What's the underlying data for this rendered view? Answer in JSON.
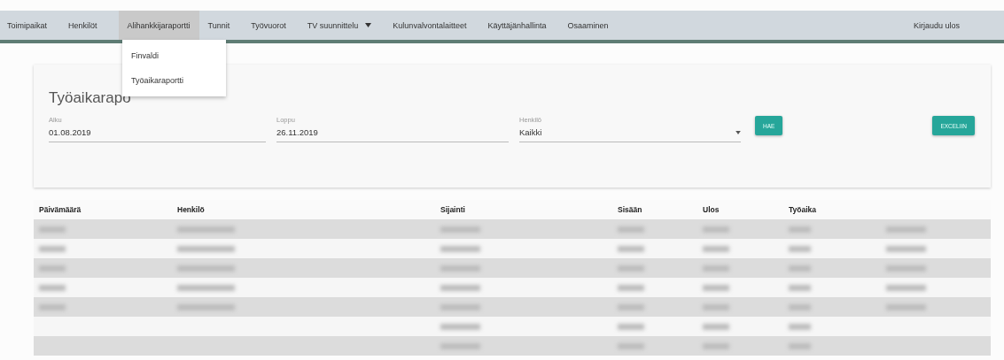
{
  "nav": {
    "items": [
      {
        "label": "Toimipaikat",
        "selected": false,
        "dropdown": false
      },
      {
        "label": "Henkilöt",
        "selected": false,
        "dropdown": false
      },
      {
        "label": "Alihankkijaraportti",
        "selected": true,
        "dropdown": false
      },
      {
        "label": "Tunnit",
        "selected": false,
        "dropdown": false
      },
      {
        "label": "Työvuorot",
        "selected": false,
        "dropdown": false
      },
      {
        "label": "TV suunnittelu",
        "selected": false,
        "dropdown": true
      },
      {
        "label": "Kulunvalvontalaitteet",
        "selected": false,
        "dropdown": false
      },
      {
        "label": "Käyttäjänhallinta",
        "selected": false,
        "dropdown": false
      },
      {
        "label": "Osaaminen",
        "selected": false,
        "dropdown": false
      }
    ],
    "logout": "Kirjaudu ulos"
  },
  "menu": {
    "items": [
      "Finvaldi",
      "Työaikaraportti"
    ]
  },
  "card": {
    "title": "Työaikarapo",
    "fields": [
      {
        "label": "Alku",
        "value": "01.08.2019",
        "kind": "text"
      },
      {
        "label": "Loppu",
        "value": "26.11.2019",
        "kind": "text"
      },
      {
        "label": "Henkilö",
        "value": "Kaikki",
        "kind": "select"
      }
    ],
    "search_button": "HAE",
    "export_button": "EXCELIIN"
  },
  "table": {
    "columns": [
      "Päivämäärä",
      "Henkilö",
      "Sijainti",
      "Sisään",
      "Ulos",
      "Työaika"
    ],
    "rows": [
      {
        "striped": true,
        "blurred": [
          true,
          true,
          true,
          true,
          true,
          true,
          true
        ]
      },
      {
        "striped": false,
        "blurred": [
          true,
          true,
          true,
          true,
          true,
          true,
          true
        ]
      },
      {
        "striped": true,
        "blurred": [
          true,
          true,
          true,
          true,
          true,
          true,
          true
        ]
      },
      {
        "striped": false,
        "blurred": [
          true,
          true,
          true,
          true,
          true,
          true,
          true
        ]
      },
      {
        "striped": true,
        "blurred": [
          true,
          true,
          true,
          true,
          true,
          true,
          true
        ]
      },
      {
        "striped": false,
        "blurred": [
          false,
          false,
          true,
          true,
          true,
          true,
          false
        ]
      },
      {
        "striped": true,
        "blurred": [
          false,
          false,
          true,
          true,
          true,
          true,
          false
        ]
      }
    ]
  }
}
